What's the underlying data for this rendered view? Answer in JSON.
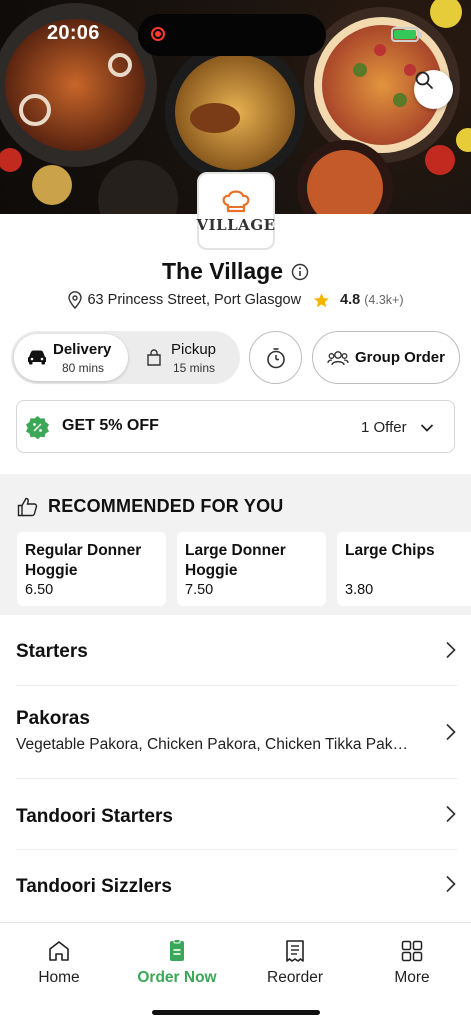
{
  "status_bar": {
    "time": "20:06"
  },
  "colors": {
    "brand_green": "#3aa856",
    "star": "#f5b400",
    "offer_badge": "#3aa856"
  },
  "restaurant": {
    "logo_text": "VILLAGE",
    "name": "The Village",
    "address": "63 Princess Street, Port Glasgow",
    "rating": "4.8",
    "rating_count": "(4.3k+)"
  },
  "modes": {
    "delivery": {
      "label": "Delivery",
      "time": "80 mins"
    },
    "pickup": {
      "label": "Pickup",
      "time": "15 mins"
    },
    "group_order": "Group Order"
  },
  "offer": {
    "title": "GET 5% OFF",
    "count": "1 Offer"
  },
  "recommended": {
    "heading": "RECOMMENDED FOR YOU",
    "items": [
      {
        "name": "Regular Donner Hoggie",
        "price": "6.50"
      },
      {
        "name": "Large Donner Hoggie",
        "price": "7.50"
      },
      {
        "name": "Large Chips",
        "price": "3.80"
      }
    ]
  },
  "categories": [
    {
      "name": "Starters",
      "desc": ""
    },
    {
      "name": "Pakoras",
      "desc": "Vegetable Pakora, Chicken Pakora, Chicken Tikka Pakora"
    },
    {
      "name": "Tandoori Starters",
      "desc": ""
    },
    {
      "name": "Tandoori Sizzlers",
      "desc": ""
    }
  ],
  "nav": [
    {
      "label": "Home",
      "icon": "home-icon"
    },
    {
      "label": "Order Now",
      "icon": "order-icon"
    },
    {
      "label": "Reorder",
      "icon": "receipt-icon"
    },
    {
      "label": "More",
      "icon": "grid-icon"
    }
  ]
}
